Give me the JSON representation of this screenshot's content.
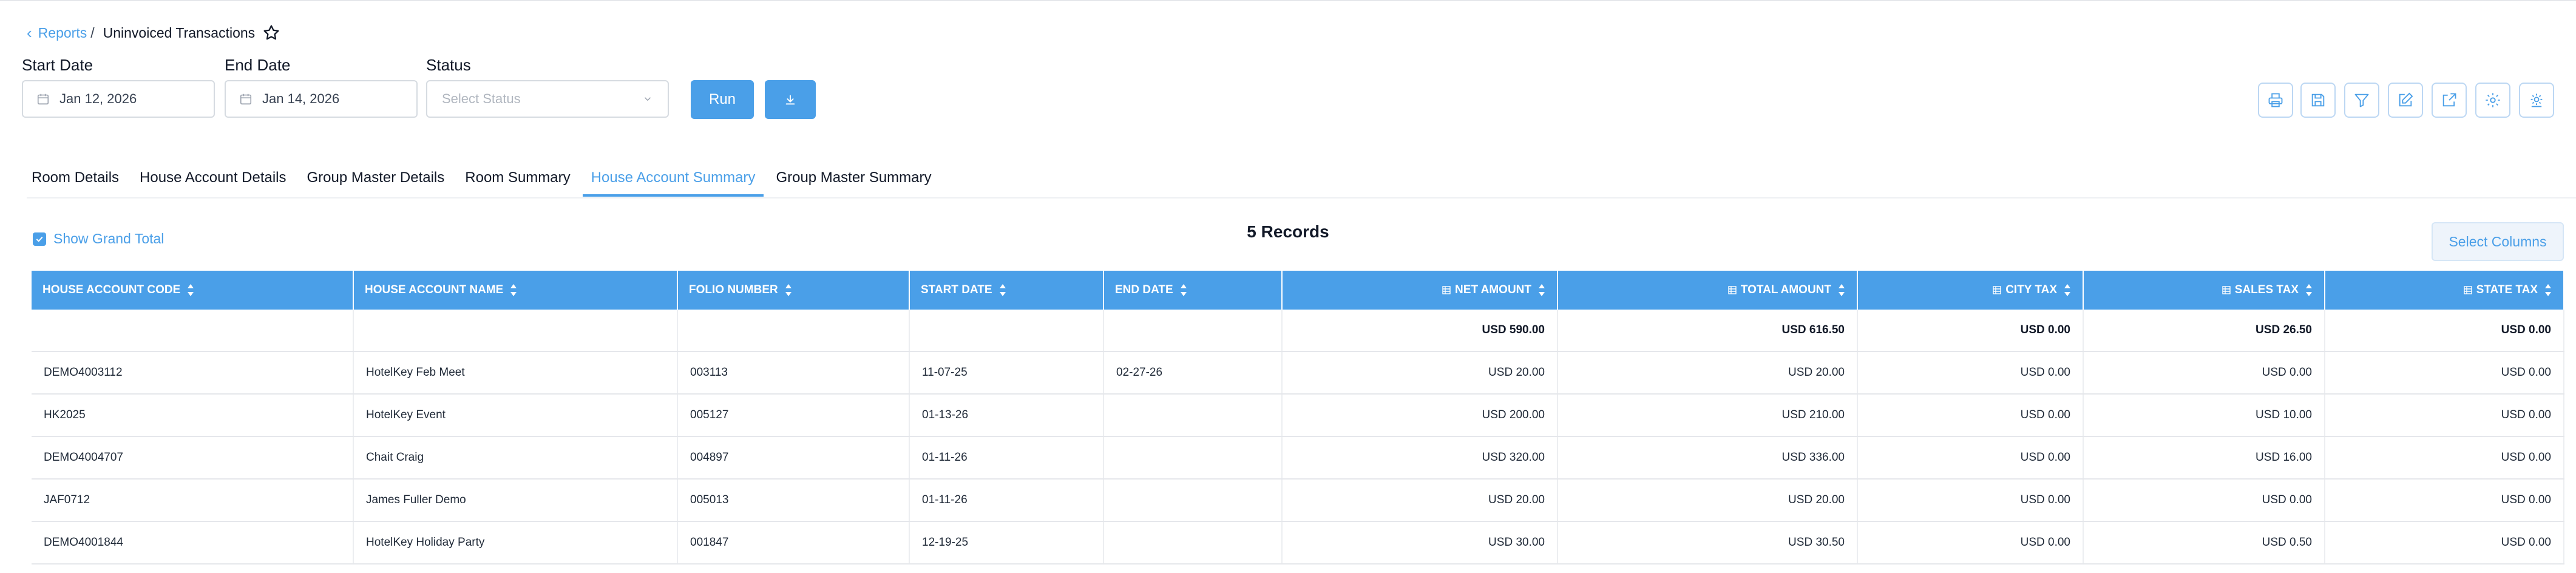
{
  "breadcrumb": {
    "parent": "Reports",
    "separator": "/",
    "current": "Uninvoiced Transactions"
  },
  "filters": {
    "start_date_label": "Start Date",
    "start_date_value": "Jan 12, 2026",
    "end_date_label": "End Date",
    "end_date_value": "Jan 14, 2026",
    "status_label": "Status",
    "status_placeholder": "Select Status",
    "run_label": "Run"
  },
  "toolbar_icons": [
    "print-icon",
    "save-icon",
    "filter-icon",
    "edit-icon",
    "export-icon",
    "settings-icon",
    "advanced-settings-icon"
  ],
  "tabs": [
    {
      "label": "Room Details",
      "active": false
    },
    {
      "label": "House Account Details",
      "active": false
    },
    {
      "label": "Group Master Details",
      "active": false
    },
    {
      "label": "Room Summary",
      "active": false
    },
    {
      "label": "House Account Summary",
      "active": true
    },
    {
      "label": "Group Master Summary",
      "active": false
    }
  ],
  "summary": {
    "show_grand_total_label": "Show Grand Total",
    "show_grand_total_checked": true,
    "records_text": "5 Records",
    "select_columns_label": "Select Columns"
  },
  "table": {
    "columns": [
      "HOUSE ACCOUNT CODE",
      "HOUSE ACCOUNT NAME",
      "FOLIO NUMBER",
      "START DATE",
      "END DATE",
      "NET AMOUNT",
      "TOTAL AMOUNT",
      "CITY TAX",
      "SALES TAX",
      "STATE TAX"
    ],
    "totals": [
      "",
      "",
      "",
      "",
      "",
      "USD 590.00",
      "USD 616.50",
      "USD 0.00",
      "USD 26.50",
      "USD 0.00"
    ],
    "rows": [
      [
        "DEMO4003112",
        "HotelKey Feb Meet",
        "003113",
        "11-07-25",
        "02-27-26",
        "USD 20.00",
        "USD 20.00",
        "USD 0.00",
        "USD 0.00",
        "USD 0.00"
      ],
      [
        "HK2025",
        "HotelKey Event",
        "005127",
        "01-13-26",
        "",
        "USD 200.00",
        "USD 210.00",
        "USD 0.00",
        "USD 10.00",
        "USD 0.00"
      ],
      [
        "DEMO4004707",
        "Chait Craig",
        "004897",
        "01-11-26",
        "",
        "USD 320.00",
        "USD 336.00",
        "USD 0.00",
        "USD 16.00",
        "USD 0.00"
      ],
      [
        "JAF0712",
        "James Fuller Demo",
        "005013",
        "01-11-26",
        "",
        "USD 20.00",
        "USD 20.00",
        "USD 0.00",
        "USD 0.00",
        "USD 0.00"
      ],
      [
        "DEMO4001844",
        "HotelKey Holiday Party",
        "001847",
        "12-19-25",
        "",
        "USD 30.00",
        "USD 30.50",
        "USD 0.00",
        "USD 0.50",
        "USD 0.00"
      ]
    ]
  },
  "colors": {
    "accent": "#4a9fe8",
    "border": "#d6dbe1"
  }
}
